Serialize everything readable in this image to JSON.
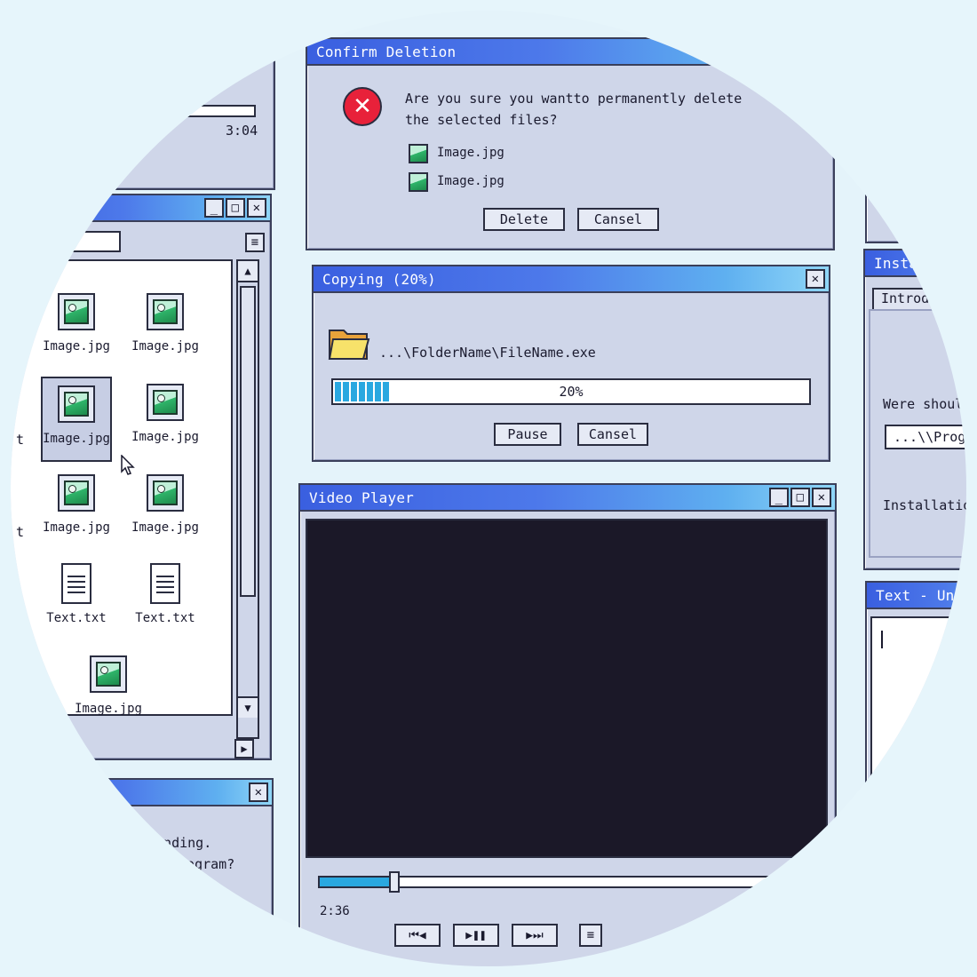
{
  "top_left_window": {
    "time": "3:04"
  },
  "explorer": {
    "files": [
      {
        "name": "Image.jpg",
        "type": "image",
        "selected": false
      },
      {
        "name": "Image.jpg",
        "type": "image",
        "selected": false
      },
      {
        "name": "Image.jpg",
        "type": "image",
        "selected": true
      },
      {
        "name": "Image.jpg",
        "type": "image",
        "selected": false
      },
      {
        "name": "Image.jpg",
        "type": "image",
        "selected": false
      },
      {
        "name": "Image.jpg",
        "type": "image",
        "selected": false
      },
      {
        "name": "Text.txt",
        "type": "text",
        "selected": false
      },
      {
        "name": "Text.txt",
        "type": "text",
        "selected": false
      },
      {
        "name": "Image.jpg",
        "type": "image",
        "selected": false
      }
    ],
    "clipped_left_labels": [
      "t",
      "t"
    ]
  },
  "confirm_deletion": {
    "title": "Confirm Deletion",
    "message_line1": "Are you sure you wantto permanently delete",
    "message_line2": "the selected files?",
    "files": [
      "Image.jpg",
      "Image.jpg"
    ],
    "delete_label": "Delete",
    "cancel_label": "Cansel",
    "error_icon_color": "#e8213a"
  },
  "copying": {
    "title": "Copying (20%)",
    "path": "...\\FolderName\\FileName.exe",
    "progress": 0.2,
    "progress_label": "20%",
    "pause_label": "Pause",
    "cancel_label": "Cansel"
  },
  "video_player": {
    "title": "Video Player",
    "current_time": "2:36",
    "seek_fraction": 0.137,
    "screen_color": "#1b1828"
  },
  "not_responding": {
    "line1": "ponding.",
    "line2": "Program?"
  },
  "installer": {
    "title": "Installa",
    "tab_label": "Introduc",
    "question": "Were should",
    "path_value": "...\\\\Program",
    "size_label": "Installation Si"
  },
  "text_editor": {
    "title": "Text - Untitle"
  },
  "colors": {
    "title_gradient_start": "#3a5fe0",
    "title_gradient_end": "#8fd6f7",
    "window_bg": "#cfd6e9",
    "progress_fill": "#2aa8e0"
  }
}
